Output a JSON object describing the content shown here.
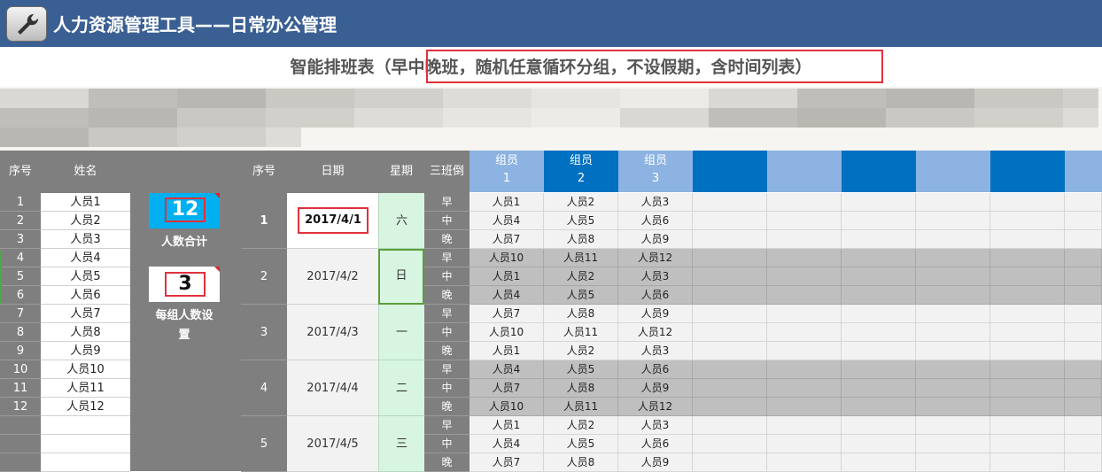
{
  "app": {
    "title": "人力资源管理工具——日常办公管理",
    "icon": "wrench-icon"
  },
  "sheet": {
    "title": "智能排班表（早中晚班，随机任意循环分组，不设假期，含时间列表）"
  },
  "left_table": {
    "headers": {
      "seq": "序号",
      "name": "姓名"
    },
    "rows": [
      {
        "seq": "1",
        "name": "人员1"
      },
      {
        "seq": "2",
        "name": "人员2"
      },
      {
        "seq": "3",
        "name": "人员3"
      },
      {
        "seq": "4",
        "name": "人员4"
      },
      {
        "seq": "5",
        "name": "人员5"
      },
      {
        "seq": "6",
        "name": "人员6"
      },
      {
        "seq": "7",
        "name": "人员7"
      },
      {
        "seq": "8",
        "name": "人员8"
      },
      {
        "seq": "9",
        "name": "人员9"
      },
      {
        "seq": "10",
        "name": "人员10"
      },
      {
        "seq": "11",
        "name": "人员11"
      },
      {
        "seq": "12",
        "name": "人员12"
      }
    ]
  },
  "stats": {
    "total_value": "12",
    "total_label": "人数合计",
    "group_value": "3",
    "group_label_1": "每组人数设",
    "group_label_2": "置"
  },
  "schedule": {
    "headers": {
      "seq": "序号",
      "date": "日期",
      "week": "星期",
      "shift": "三班倒",
      "members": [
        {
          "label": "组员",
          "num": "1"
        },
        {
          "label": "组员",
          "num": "2"
        },
        {
          "label": "组员",
          "num": "3"
        }
      ]
    },
    "days": [
      {
        "seq": "1",
        "date": "2017/4/1",
        "week": "六",
        "shifts": [
          {
            "shift": "早",
            "members": [
              "人员1",
              "人员2",
              "人员3"
            ]
          },
          {
            "shift": "中",
            "members": [
              "人员4",
              "人员5",
              "人员6"
            ]
          },
          {
            "shift": "晚",
            "members": [
              "人员7",
              "人员8",
              "人员9"
            ]
          }
        ]
      },
      {
        "seq": "2",
        "date": "2017/4/2",
        "week": "日",
        "shifts": [
          {
            "shift": "早",
            "members": [
              "人员10",
              "人员11",
              "人员12"
            ]
          },
          {
            "shift": "中",
            "members": [
              "人员1",
              "人员2",
              "人员3"
            ]
          },
          {
            "shift": "晚",
            "members": [
              "人员4",
              "人员5",
              "人员6"
            ]
          }
        ]
      },
      {
        "seq": "3",
        "date": "2017/4/3",
        "week": "一",
        "shifts": [
          {
            "shift": "早",
            "members": [
              "人员7",
              "人员8",
              "人员9"
            ]
          },
          {
            "shift": "中",
            "members": [
              "人员10",
              "人员11",
              "人员12"
            ]
          },
          {
            "shift": "晚",
            "members": [
              "人员1",
              "人员2",
              "人员3"
            ]
          }
        ]
      },
      {
        "seq": "4",
        "date": "2017/4/4",
        "week": "二",
        "shifts": [
          {
            "shift": "早",
            "members": [
              "人员4",
              "人员5",
              "人员6"
            ]
          },
          {
            "shift": "中",
            "members": [
              "人员7",
              "人员8",
              "人员9"
            ]
          },
          {
            "shift": "晚",
            "members": [
              "人员10",
              "人员11",
              "人员12"
            ]
          }
        ]
      },
      {
        "seq": "5",
        "date": "2017/4/5",
        "week": "三",
        "shifts": [
          {
            "shift": "早",
            "members": [
              "人员1",
              "人员2",
              "人员3"
            ]
          },
          {
            "shift": "中",
            "members": [
              "人员4",
              "人员5",
              "人员6"
            ]
          },
          {
            "shift": "晚",
            "members": [
              "人员7",
              "人员8",
              "人员9"
            ]
          }
        ]
      }
    ]
  },
  "colors": {
    "title_bar": "#3a5f93",
    "header_gray": "#7f7f7f",
    "member_light": "#8db3e2",
    "member_dark": "#0070c0",
    "week_bg": "#d8f5e2",
    "stat_blue": "#00b0f0",
    "highlight_red": "#e0313d"
  }
}
